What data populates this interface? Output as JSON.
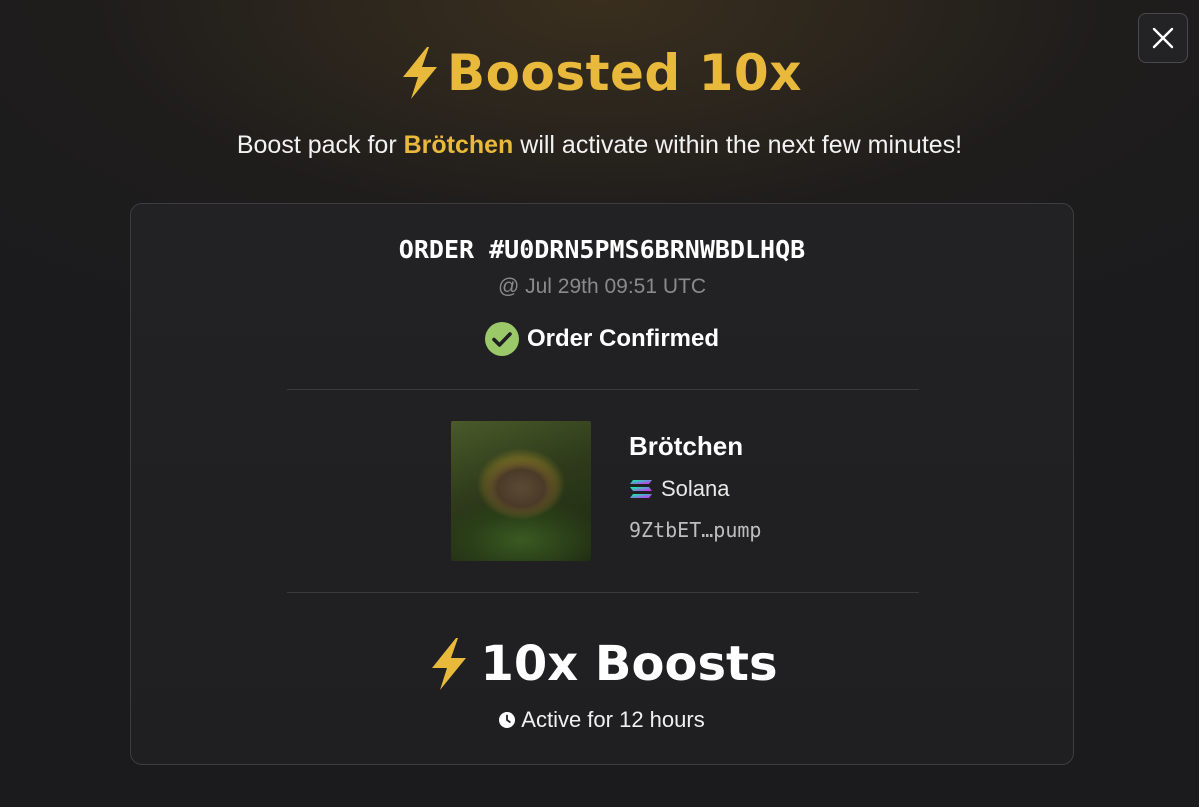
{
  "modal": {
    "title": "Boosted 10x",
    "subtitle_prefix": "Boost pack for ",
    "subtitle_token": "Brötchen",
    "subtitle_suffix": " will activate within the next few minutes!",
    "close_icon": "close-icon"
  },
  "order": {
    "id_label": "ORDER #U0DRN5PMS6BRNWBDLHQB",
    "timestamp": "@ Jul 29th 09:51 UTC",
    "status": "Order Confirmed",
    "status_icon": "check-circle-icon"
  },
  "token": {
    "name": "Brötchen",
    "chain": "Solana",
    "chain_icon": "solana-icon",
    "address": "9ZtbET…pump"
  },
  "boost": {
    "label": "10x Boosts",
    "icon": "lightning-icon",
    "duration": "Active for 12 hours",
    "duration_icon": "clock-icon"
  },
  "colors": {
    "accent": "#e8b93a",
    "confirm": "#9bc96a",
    "muted": "#8a8a8d"
  }
}
